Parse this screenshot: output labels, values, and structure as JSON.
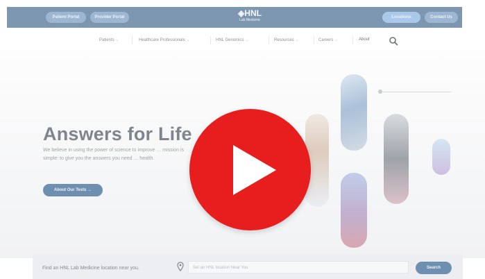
{
  "header": {
    "patient_portal": "Patient Portal",
    "provider_portal": "Provider Portal",
    "logo": "HNL",
    "logo_sub": "Lab Medicine",
    "locations": "Locations",
    "contact": "Contact Us"
  },
  "nav": {
    "items": [
      "Patients",
      "Healthcare Professionals",
      "HNL Genomics",
      "Resources",
      "Careers",
      "About"
    ]
  },
  "hero": {
    "title": "Answers for Life",
    "description": "We believe in using the power of science to improve … mission is simple: to give you the answers you need … health.",
    "button": "About Our Tests"
  },
  "find": {
    "label": "Find an HNL Lab Medicine location near you.",
    "placeholder": "Set an HNL location Near You",
    "button": "Search"
  },
  "colors": {
    "brand": "#7e97b1",
    "button": "#6f8fb1",
    "play": "#e81e1e"
  },
  "icons": [
    "location-pin-icon",
    "search-icon",
    "play-icon",
    "arrow-right-icon",
    "chevron-down-icon"
  ]
}
